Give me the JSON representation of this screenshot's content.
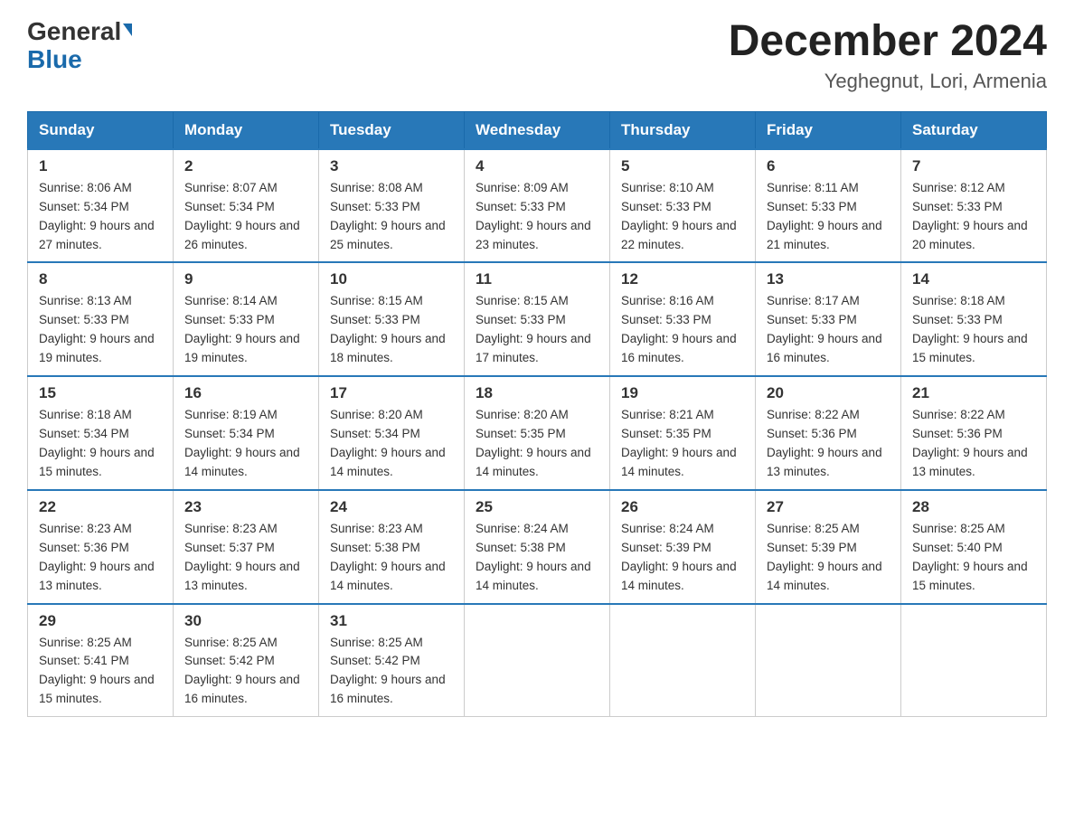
{
  "header": {
    "logo_general": "General",
    "logo_blue": "Blue",
    "month_title": "December 2024",
    "location": "Yeghegnut, Lori, Armenia"
  },
  "days_of_week": [
    "Sunday",
    "Monday",
    "Tuesday",
    "Wednesday",
    "Thursday",
    "Friday",
    "Saturday"
  ],
  "weeks": [
    [
      {
        "day": "1",
        "sunrise": "8:06 AM",
        "sunset": "5:34 PM",
        "daylight": "9 hours and 27 minutes."
      },
      {
        "day": "2",
        "sunrise": "8:07 AM",
        "sunset": "5:34 PM",
        "daylight": "9 hours and 26 minutes."
      },
      {
        "day": "3",
        "sunrise": "8:08 AM",
        "sunset": "5:33 PM",
        "daylight": "9 hours and 25 minutes."
      },
      {
        "day": "4",
        "sunrise": "8:09 AM",
        "sunset": "5:33 PM",
        "daylight": "9 hours and 23 minutes."
      },
      {
        "day": "5",
        "sunrise": "8:10 AM",
        "sunset": "5:33 PM",
        "daylight": "9 hours and 22 minutes."
      },
      {
        "day": "6",
        "sunrise": "8:11 AM",
        "sunset": "5:33 PM",
        "daylight": "9 hours and 21 minutes."
      },
      {
        "day": "7",
        "sunrise": "8:12 AM",
        "sunset": "5:33 PM",
        "daylight": "9 hours and 20 minutes."
      }
    ],
    [
      {
        "day": "8",
        "sunrise": "8:13 AM",
        "sunset": "5:33 PM",
        "daylight": "9 hours and 19 minutes."
      },
      {
        "day": "9",
        "sunrise": "8:14 AM",
        "sunset": "5:33 PM",
        "daylight": "9 hours and 19 minutes."
      },
      {
        "day": "10",
        "sunrise": "8:15 AM",
        "sunset": "5:33 PM",
        "daylight": "9 hours and 18 minutes."
      },
      {
        "day": "11",
        "sunrise": "8:15 AM",
        "sunset": "5:33 PM",
        "daylight": "9 hours and 17 minutes."
      },
      {
        "day": "12",
        "sunrise": "8:16 AM",
        "sunset": "5:33 PM",
        "daylight": "9 hours and 16 minutes."
      },
      {
        "day": "13",
        "sunrise": "8:17 AM",
        "sunset": "5:33 PM",
        "daylight": "9 hours and 16 minutes."
      },
      {
        "day": "14",
        "sunrise": "8:18 AM",
        "sunset": "5:33 PM",
        "daylight": "9 hours and 15 minutes."
      }
    ],
    [
      {
        "day": "15",
        "sunrise": "8:18 AM",
        "sunset": "5:34 PM",
        "daylight": "9 hours and 15 minutes."
      },
      {
        "day": "16",
        "sunrise": "8:19 AM",
        "sunset": "5:34 PM",
        "daylight": "9 hours and 14 minutes."
      },
      {
        "day": "17",
        "sunrise": "8:20 AM",
        "sunset": "5:34 PM",
        "daylight": "9 hours and 14 minutes."
      },
      {
        "day": "18",
        "sunrise": "8:20 AM",
        "sunset": "5:35 PM",
        "daylight": "9 hours and 14 minutes."
      },
      {
        "day": "19",
        "sunrise": "8:21 AM",
        "sunset": "5:35 PM",
        "daylight": "9 hours and 14 minutes."
      },
      {
        "day": "20",
        "sunrise": "8:22 AM",
        "sunset": "5:36 PM",
        "daylight": "9 hours and 13 minutes."
      },
      {
        "day": "21",
        "sunrise": "8:22 AM",
        "sunset": "5:36 PM",
        "daylight": "9 hours and 13 minutes."
      }
    ],
    [
      {
        "day": "22",
        "sunrise": "8:23 AM",
        "sunset": "5:36 PM",
        "daylight": "9 hours and 13 minutes."
      },
      {
        "day": "23",
        "sunrise": "8:23 AM",
        "sunset": "5:37 PM",
        "daylight": "9 hours and 13 minutes."
      },
      {
        "day": "24",
        "sunrise": "8:23 AM",
        "sunset": "5:38 PM",
        "daylight": "9 hours and 14 minutes."
      },
      {
        "day": "25",
        "sunrise": "8:24 AM",
        "sunset": "5:38 PM",
        "daylight": "9 hours and 14 minutes."
      },
      {
        "day": "26",
        "sunrise": "8:24 AM",
        "sunset": "5:39 PM",
        "daylight": "9 hours and 14 minutes."
      },
      {
        "day": "27",
        "sunrise": "8:25 AM",
        "sunset": "5:39 PM",
        "daylight": "9 hours and 14 minutes."
      },
      {
        "day": "28",
        "sunrise": "8:25 AM",
        "sunset": "5:40 PM",
        "daylight": "9 hours and 15 minutes."
      }
    ],
    [
      {
        "day": "29",
        "sunrise": "8:25 AM",
        "sunset": "5:41 PM",
        "daylight": "9 hours and 15 minutes."
      },
      {
        "day": "30",
        "sunrise": "8:25 AM",
        "sunset": "5:42 PM",
        "daylight": "9 hours and 16 minutes."
      },
      {
        "day": "31",
        "sunrise": "8:25 AM",
        "sunset": "5:42 PM",
        "daylight": "9 hours and 16 minutes."
      },
      null,
      null,
      null,
      null
    ]
  ]
}
